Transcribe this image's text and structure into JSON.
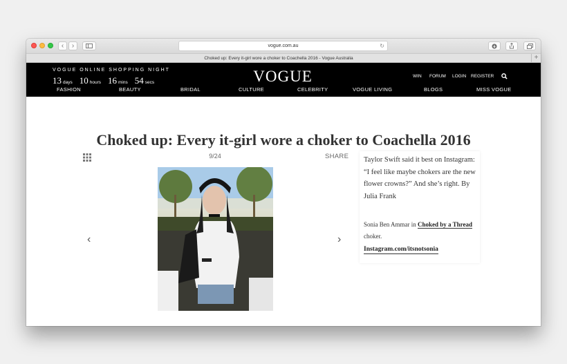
{
  "browser": {
    "url": "vogue.com.au",
    "tab_title": "Choked up: Every it-girl wore a choker to Coachella 2016 - Vogue Australia"
  },
  "header": {
    "promo": "VOGUE ONLINE SHOPPING NIGHT",
    "countdown": [
      {
        "value": "13",
        "unit": "days"
      },
      {
        "value": "10",
        "unit": "hours"
      },
      {
        "value": "16",
        "unit": "mins"
      },
      {
        "value": "54",
        "unit": "secs"
      }
    ],
    "logo": "VOGUE",
    "util_links": [
      "WIN",
      "FORUM",
      "LOGIN",
      "REGISTER"
    ],
    "nav": [
      "FASHION",
      "BEAUTY",
      "BRIDAL",
      "CULTURE",
      "CELEBRITY",
      "VOGUE LIVING",
      "BLOGS",
      "MISS VOGUE"
    ]
  },
  "article": {
    "title": "Choked up: Every it-girl wore a choker to Coachella 2016",
    "counter": "9/24",
    "share_label": "SHARE",
    "quote": "Taylor Swift said it best on Instagram: “I feel like maybe chokers are the new flower crowns?” And she’s right. By Julia Frank",
    "credit_prefix": "Sonia Ben Ammar in",
    "credit_link": "Choked by a Thread",
    "credit_suffix": "choker.",
    "instagram": "Instagram.com/itsnotsonia",
    "prev_arrow": "‹",
    "next_arrow": "›"
  },
  "colors": {
    "header_bg": "#000000",
    "page_bg": "#f0f0f0"
  }
}
